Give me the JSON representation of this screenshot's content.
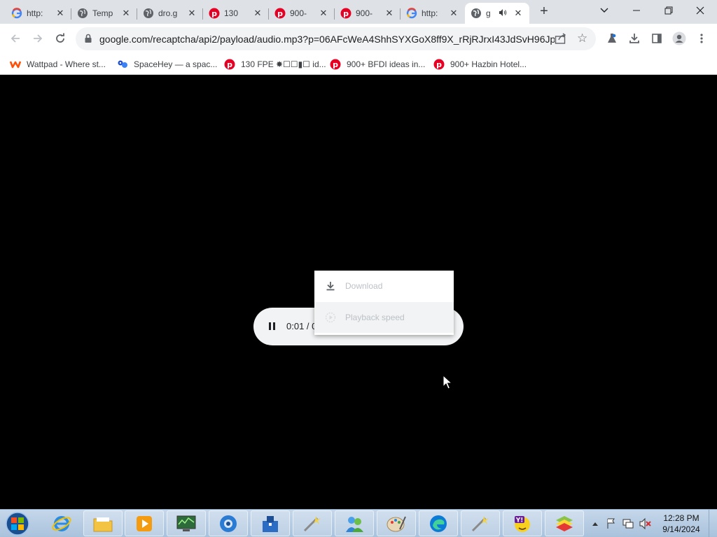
{
  "tabs": [
    {
      "title": "http:",
      "favicon": "google-g-icon"
    },
    {
      "title": "Temp",
      "favicon": "globe-icon"
    },
    {
      "title": "dro.g",
      "favicon": "globe-icon"
    },
    {
      "title": "130",
      "favicon": "pinterest-icon"
    },
    {
      "title": "900-",
      "favicon": "pinterest-icon"
    },
    {
      "title": "900-",
      "favicon": "pinterest-icon"
    },
    {
      "title": "http:",
      "favicon": "google-g-icon"
    },
    {
      "title": "g",
      "favicon": "globe-icon",
      "active": true,
      "audio": true
    }
  ],
  "omnibox": {
    "url": "google.com/recaptcha/api2/payload/audio.mp3?p=06AFcWeA4ShhSYXGoX8ff9X_rRjRJrxI43JdSvH96Jp..."
  },
  "bookmarks": [
    {
      "label": "Wattpad - Where st...",
      "icon": "wattpad-icon"
    },
    {
      "label": "SpaceHey — a spac...",
      "icon": "spacehey-icon"
    },
    {
      "label": "130 FPE ✸☐☐▮☐ id...",
      "icon": "pinterest-icon"
    },
    {
      "label": "900+ BFDI ideas in...",
      "icon": "pinterest-icon"
    },
    {
      "label": "900+ Hazbin Hotel...",
      "icon": "pinterest-icon"
    }
  ],
  "player": {
    "time": "0:01 / 0"
  },
  "menu": {
    "download": "Download",
    "playback_speed": "Playback speed"
  },
  "taskbar": {
    "apps": [
      "internet-explorer",
      "file-explorer",
      "media-player",
      "system-monitor",
      "chrome-like-browser",
      "toolbox",
      "paint-wand",
      "windows-live",
      "paint",
      "edge",
      "paint-wand",
      "yahoo-messenger",
      "bluestacks"
    ],
    "clock_time": "12:28 PM",
    "clock_date": "9/14/2024"
  },
  "colors": {
    "pinterest": "#e60023",
    "wattpad": "#ff500a",
    "page_bg": "#000000"
  }
}
